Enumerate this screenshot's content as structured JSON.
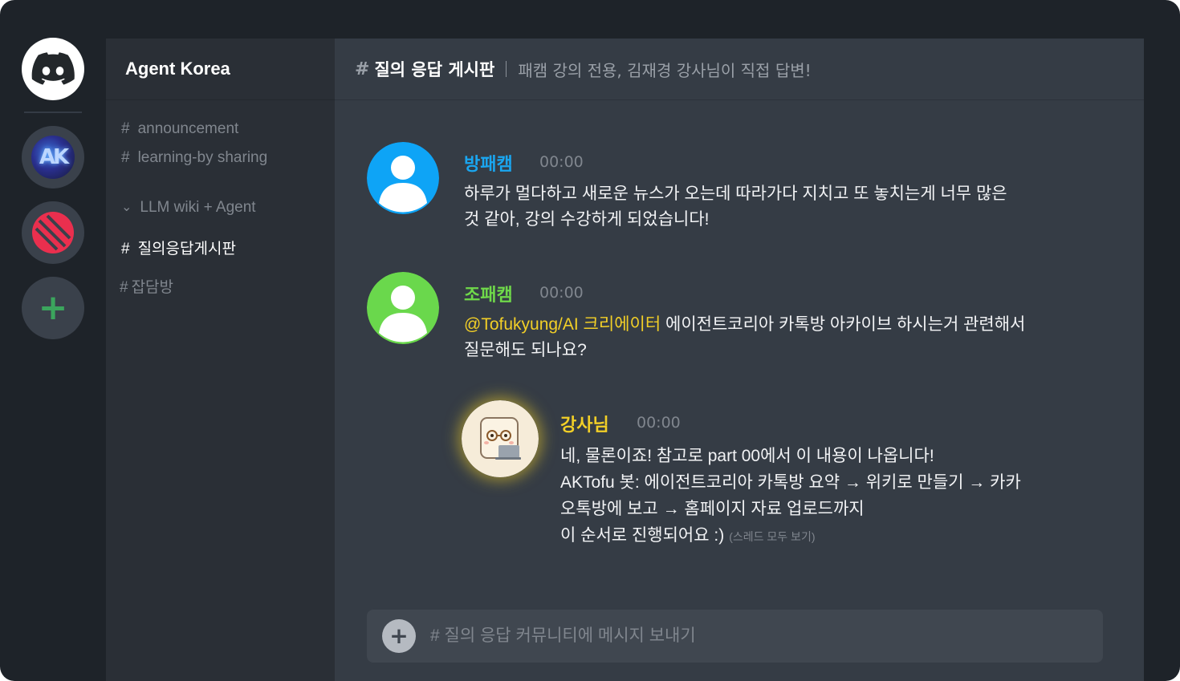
{
  "server_rail": {
    "home_icon": "discord-logo-icon",
    "servers": [
      {
        "name": "agent-korea-server",
        "initials": "AK"
      },
      {
        "name": "red-server-icon"
      }
    ],
    "add_server_icon": "plus-icon"
  },
  "sidebar": {
    "server_name": "Agent Korea",
    "channels": [
      {
        "prefix": "#",
        "label": "announcement"
      },
      {
        "prefix": "#",
        "label": "learning-by sharing"
      },
      {
        "prefix": "⌄",
        "label": "LLM wiki + Agent"
      },
      {
        "prefix": "#",
        "label": "질의응답게시판",
        "active": true
      },
      {
        "prefix": "#",
        "label": "잡담방"
      }
    ]
  },
  "channel_header": {
    "hash": "#",
    "title": "질의 응답 게시판",
    "topic": "패캠 강의 전용, 김재경 강사님이 직접 답변!"
  },
  "messages": [
    {
      "author": "방패캠",
      "author_color": "#1aa6f0",
      "avatar_color": "#0fa3f5",
      "time": "00:00",
      "lines": [
        "하루가 멀다하고 새로운 뉴스가 오는데 따라가다 지치고 또 놓치는게 너무 많은",
        "것 같아, 강의 수강하게 되었습니다!"
      ]
    },
    {
      "author": "조패캠",
      "author_color": "#6fd84a",
      "avatar_color": "#6ad84c",
      "time": "00:00",
      "mention": "@Tofukyung/AI 크리에이터",
      "lines": [
        " 에이전트코리아 카톡방 아카이브 하시는거 관련해서",
        "질문해도 되나요?"
      ]
    },
    {
      "author": "강사님",
      "author_color": "#f2cf27",
      "time": "00:00",
      "lines": [
        "네, 물론이죠! 참고로 part 00에서 이 내용이 나옵니다!",
        "AKTofu 봇: 에이전트코리아 카톡방 요약 → 위키로 만들기 → 카카",
        "오톡방에 보고 → 홈페이지 자료 업로드까지",
        "이 순서로 진행되어요 :)"
      ],
      "thread_link": "(스레드 모두 보기)"
    }
  ],
  "composer": {
    "placeholder": "# 질의 응답 커뮤니티에 메시지 보내기",
    "value": ""
  }
}
